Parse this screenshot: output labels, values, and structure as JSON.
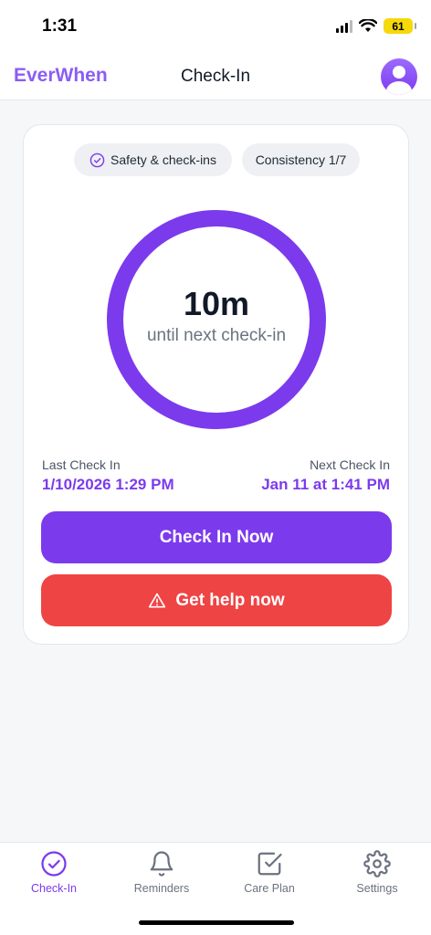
{
  "status_bar": {
    "time": "1:31",
    "battery": "61"
  },
  "header": {
    "brand": "EverWhen",
    "title": "Check-In"
  },
  "chips": {
    "safety": "Safety & check-ins",
    "consistency": "Consistency 1/7"
  },
  "countdown": {
    "value": "10m",
    "label": "until next check-in"
  },
  "last_check_in": {
    "label": "Last Check In",
    "value": "1/10/2026 1:29 PM"
  },
  "next_check_in": {
    "label": "Next Check In",
    "value": "Jan 11 at 1:41 PM"
  },
  "actions": {
    "check_in": "Check In Now",
    "help": "Get help now"
  },
  "tabs": [
    {
      "label": "Check-In",
      "icon": "check-circle-icon",
      "active": true
    },
    {
      "label": "Reminders",
      "icon": "bell-icon",
      "active": false
    },
    {
      "label": "Care Plan",
      "icon": "checkbox-icon",
      "active": false
    },
    {
      "label": "Settings",
      "icon": "gear-icon",
      "active": false
    }
  ],
  "colors": {
    "accent": "#7c3aed",
    "brand": "#8b5cf6",
    "danger": "#ef4444"
  }
}
